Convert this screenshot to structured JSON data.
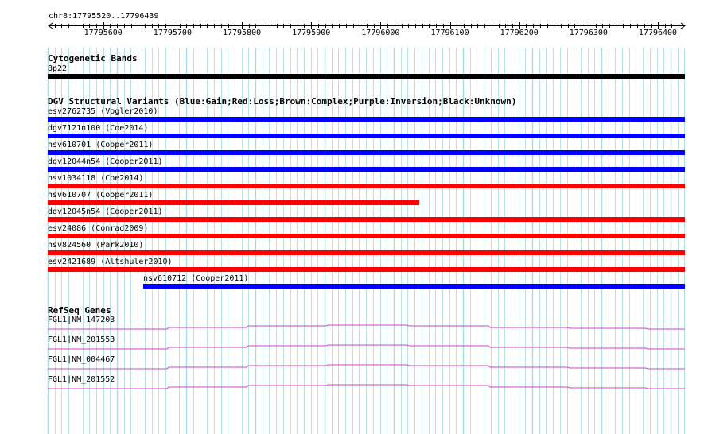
{
  "locus": "chr8:17795520..17796439",
  "ruler": {
    "ticks": [
      "17795600",
      "17795700",
      "17795800",
      "17795900",
      "17796000",
      "17796100",
      "17796200",
      "17796300",
      "17796400"
    ]
  },
  "cytoband": {
    "title": "Cytogenetic Bands",
    "band": "8p22",
    "color": "#000000"
  },
  "dgv": {
    "title": "DGV Structural Variants (Blue:Gain;Red:Loss;Brown:Complex;Purple:Inversion;Black:Unknown)",
    "colors": {
      "gain": "#0000ff",
      "loss": "#ff0000"
    },
    "items": [
      {
        "label": "esv2762735 (Vogler2010)",
        "type": "gain",
        "start": 17795520,
        "end": 17796439
      },
      {
        "label": "dgv7121n100 (Coe2014)",
        "type": "gain",
        "start": 17795520,
        "end": 17796439
      },
      {
        "label": "nsv610701 (Cooper2011)",
        "type": "gain",
        "start": 17795520,
        "end": 17796439
      },
      {
        "label": "dgv12044n54 (Cooper2011)",
        "type": "gain",
        "start": 17795520,
        "end": 17796439
      },
      {
        "label": "nsv1034118 (Coe2014)",
        "type": "loss",
        "start": 17795520,
        "end": 17796439
      },
      {
        "label": "nsv610707 (Cooper2011)",
        "type": "loss",
        "start": 17795520,
        "end": 17796056
      },
      {
        "label": "dgv12045n54 (Cooper2011)",
        "type": "loss",
        "start": 17795520,
        "end": 17796439
      },
      {
        "label": "esv24086 (Conrad2009)",
        "type": "loss",
        "start": 17795520,
        "end": 17796439
      },
      {
        "label": "nsv824560 (Park2010)",
        "type": "loss",
        "start": 17795520,
        "end": 17796439
      },
      {
        "label": "esv2421689 (Altshuler2010)",
        "type": "loss",
        "start": 17795520,
        "end": 17796439
      },
      {
        "label": "nsv610712 (Cooper2011)",
        "type": "gain",
        "start": 17795658,
        "end": 17796439
      }
    ]
  },
  "refseq": {
    "title": "RefSeq Genes",
    "color": "#cc44cc",
    "genes": [
      {
        "label": "FGL1|NM_147203"
      },
      {
        "label": "FGL1|NM_201553"
      },
      {
        "label": "FGL1|NM_004467"
      },
      {
        "label": "FGL1|NM_201552"
      }
    ]
  },
  "colors": {
    "grid": "#a8dce4",
    "axis": "#000000"
  }
}
